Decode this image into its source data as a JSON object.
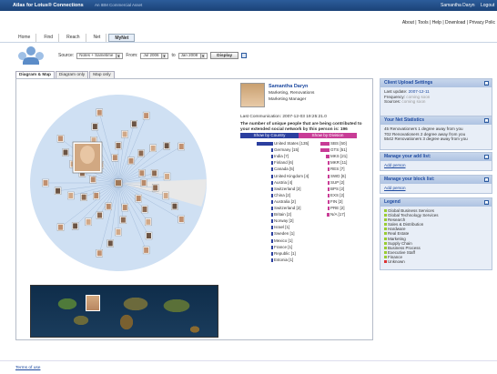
{
  "topbar": {
    "app_title": "Atlas for Lotus® Connections",
    "edition": "An IBM Commercial Asset",
    "user_name": "Samantha Daryn",
    "logout": "Logout"
  },
  "sublinks": [
    "About",
    "Tools",
    "Help",
    "Download",
    "Privacy Polic"
  ],
  "nav_tabs": [
    "Home",
    "Find",
    "Reach",
    "Net",
    "MyNet"
  ],
  "filter": {
    "source_label": "Source:",
    "source_value": "Notes + Sametime",
    "from_label": "From:",
    "from_value": "Jul 2006",
    "to_label": "to",
    "to_value": "Jan 2008",
    "display_button": "Display"
  },
  "view_tabs": [
    "Diagram & Map",
    "Diagram only",
    "Map only"
  ],
  "profile": {
    "name": "Samantha Daryn",
    "lines": [
      "Marketing, Renovations",
      "Marketing Manager"
    ],
    "last_comm": "Last Communication: 2007-12-03 19:25:21.0",
    "unique_text_1": "The number of unique people that are being contributed to",
    "unique_text_2": "your extended social network by this person is:",
    "unique_count": "196",
    "show_country": "Show by Country",
    "show_division": "Show by Division"
  },
  "chart_data": {
    "type": "bar",
    "title": "",
    "series": [
      {
        "name": "Show by Country",
        "categories": [
          "United States [135]",
          "Germany [15]",
          "India [7]",
          "Finland [6]",
          "Canada [5]",
          "United Kingdom [4]",
          "Austria [4]",
          "Switzerland [2]",
          "China [2]",
          "Australia [2]",
          "Switzerland [2]",
          "Britain [2]",
          "Norway [2]",
          "Israel [1]",
          "Sweden [1]",
          "Mexico [1]",
          "France [1]",
          "Republic [1]",
          "Estonia [1]"
        ],
        "values": [
          135,
          15,
          7,
          6,
          5,
          4,
          4,
          2,
          2,
          2,
          2,
          2,
          2,
          1,
          1,
          1,
          1,
          1,
          1
        ]
      },
      {
        "name": "Show by Division",
        "categories": [
          "SBS [50]",
          "GTS [51]",
          "MKS [21]",
          "MKR [11]",
          "RES [7]",
          "SWD [6]",
          "SUP [2]",
          "BPS [2]",
          "EXS [2]",
          "FIN [2]",
          "PRE [2]",
          "N/A [17]"
        ],
        "values": [
          50,
          51,
          21,
          11,
          7,
          6,
          2,
          2,
          2,
          2,
          2,
          17
        ]
      }
    ]
  },
  "right_panels": {
    "upload": {
      "title": "Client Upload Settings",
      "last_update_label": "Last update:",
      "last_update_value": "2007-12-11",
      "frequency_label": "Frequency:",
      "frequency_value": "coming soon",
      "sources_label": "Sources:",
      "sources_value": "coming soon"
    },
    "net_stats": {
      "title": "Your Net Statistics",
      "lines": [
        "45 Renovationers 1 degree away from you",
        "702 Renovationers 2 degree away from you",
        "5542 Renovationers 3 degree away from you"
      ]
    },
    "add_list": {
      "title": "Manage your add list:",
      "link": "Add person"
    },
    "block_list": {
      "title": "Manage your block list:",
      "link": "Add person"
    },
    "legend": {
      "title": "Legend",
      "items": [
        "Global Business Services",
        "Global Technology Services",
        "Research",
        "Sales & Distribution",
        "Hardware",
        "Real Estate",
        "Marketing",
        "Supply Chain",
        "Business Process",
        "Executive Staff",
        "Finance",
        "Unknown"
      ]
    }
  },
  "footer": {
    "terms": "Terms of use"
  },
  "colors": {
    "ring": "#cfe0f3",
    "country_bar": "#2b3f9f",
    "division_bar": "#c83c96",
    "header": "#1b4378"
  }
}
